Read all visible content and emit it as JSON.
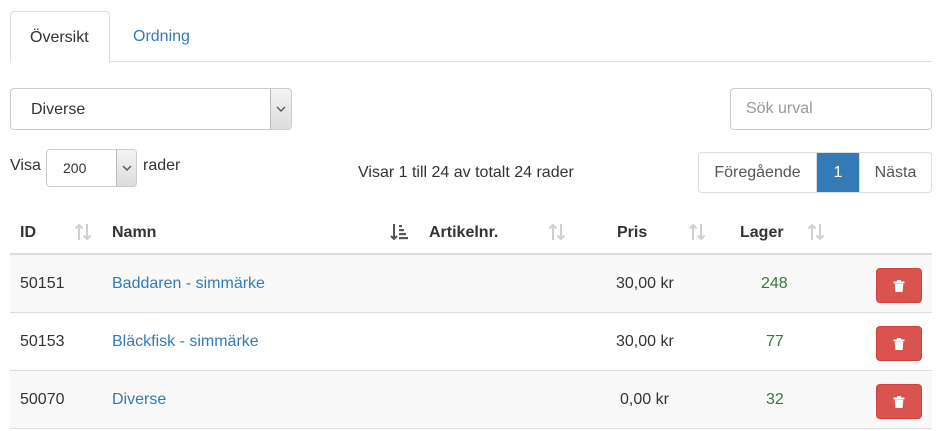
{
  "tabs": [
    {
      "label": "Översikt",
      "active": true
    },
    {
      "label": "Ordning",
      "active": false
    }
  ],
  "filter": {
    "category_value": "Diverse",
    "search_placeholder": "Sök urval"
  },
  "rows_control": {
    "prefix": "Visa",
    "value": "200",
    "suffix": "rader"
  },
  "info_text": "Visar 1 till 24 av totalt 24 rader",
  "pagination": {
    "prev": "Föregående",
    "current": "1",
    "next": "Nästa"
  },
  "table": {
    "columns": [
      "ID",
      "Namn",
      "Artikelnr.",
      "Pris",
      "Lager"
    ],
    "sorted_column": "Namn",
    "rows": [
      {
        "id": "50151",
        "name": "Baddaren - simmärke",
        "article": "",
        "price": "30,00 kr",
        "stock": "248"
      },
      {
        "id": "50153",
        "name": "Bläckfisk - simmärke",
        "article": "",
        "price": "30,00 kr",
        "stock": "77"
      },
      {
        "id": "50070",
        "name": "Diverse",
        "article": "",
        "price": "0,00 kr",
        "stock": "32"
      }
    ]
  },
  "colors": {
    "link": "#337ab7",
    "danger": "#d9534f",
    "success_text": "#3c763d"
  },
  "icons": {
    "sort_neutral": "sort-icon",
    "sort_active": "sort-amount-down-icon",
    "delete": "trash-icon",
    "dropdown": "chevron-down-icon"
  }
}
